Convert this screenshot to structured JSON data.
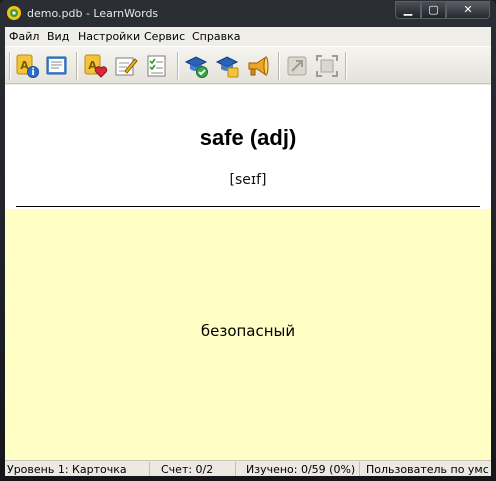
{
  "window": {
    "title": "demo.pdb - LearnWords",
    "controls": {
      "minimize": "▁",
      "maximize": "▢",
      "close": "✕"
    }
  },
  "menu": [
    "Файл",
    "Вид",
    "Настройки",
    "Сервис",
    "Справка"
  ],
  "toolbar": {
    "groups": [
      [
        "card-info-icon",
        "book-icon"
      ],
      [
        "card-favorite-icon",
        "edit-icon",
        "checklist-icon"
      ],
      [
        "graduation-check-icon",
        "graduation-icon",
        "megaphone-icon"
      ],
      [
        "fit-window-icon-disabled",
        "fullscreen-icon-disabled"
      ]
    ]
  },
  "card": {
    "word": "safe (adj)",
    "transcription": "[seɪf]",
    "translation": "безопасный"
  },
  "colors": {
    "answer_background": "#fffec4",
    "window_frame": "#1b1d21"
  },
  "status": {
    "level": "Уровень 1: Карточка",
    "score": "Счет: 0/2",
    "learned": "Изучено: 0/59  (0%)",
    "user": "Пользователь по умс"
  }
}
